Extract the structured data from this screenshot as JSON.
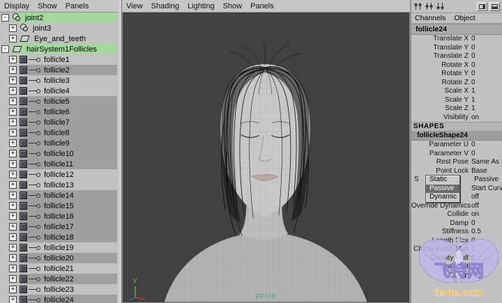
{
  "outliner": {
    "menu": [
      {
        "label": "Display"
      },
      {
        "label": "Show"
      },
      {
        "label": "Panels"
      }
    ],
    "items": [
      {
        "label": "joint2",
        "icon": "ico-joint",
        "exp": "-",
        "cls": "lvl0 hilite"
      },
      {
        "label": "joint3",
        "icon": "ico-joint",
        "exp": "+",
        "cls": "lvl1"
      },
      {
        "label": "Eye_and_teeth",
        "icon": "ico-mesh",
        "exp": "+",
        "cls": "lvl1"
      },
      {
        "label": "hairSystem1Follicles",
        "icon": "ico-mesh",
        "exp": "-",
        "cls": "lvl0 hilite"
      },
      {
        "label": "follicle1",
        "icon": "ico-follicle",
        "exp": "+",
        "cls": "lvl1 conn"
      },
      {
        "label": "follicle2",
        "icon": "ico-follicle",
        "exp": "+",
        "cls": "lvl1 conn sel"
      },
      {
        "label": "follicle3",
        "icon": "ico-follicle",
        "exp": "+",
        "cls": "lvl1 conn"
      },
      {
        "label": "follicle4",
        "icon": "ico-follicle",
        "exp": "+",
        "cls": "lvl1 conn"
      },
      {
        "label": "follicle5",
        "icon": "ico-follicle",
        "exp": "+",
        "cls": "lvl1 conn sel"
      },
      {
        "label": "follicle6",
        "icon": "ico-follicle",
        "exp": "+",
        "cls": "lvl1 conn sel"
      },
      {
        "label": "follicle7",
        "icon": "ico-follicle",
        "exp": "+",
        "cls": "lvl1 conn sel"
      },
      {
        "label": "follicle8",
        "icon": "ico-follicle",
        "exp": "+",
        "cls": "lvl1 conn sel"
      },
      {
        "label": "follicle9",
        "icon": "ico-follicle",
        "exp": "+",
        "cls": "lvl1 conn sel"
      },
      {
        "label": "follicle10",
        "icon": "ico-follicle",
        "exp": "+",
        "cls": "lvl1 conn sel"
      },
      {
        "label": "follicle11",
        "icon": "ico-follicle",
        "exp": "+",
        "cls": "lvl1 conn sel"
      },
      {
        "label": "follicle12",
        "icon": "ico-follicle",
        "exp": "+",
        "cls": "lvl1 conn"
      },
      {
        "label": "follicle13",
        "icon": "ico-follicle",
        "exp": "+",
        "cls": "lvl1 conn"
      },
      {
        "label": "follicle14",
        "icon": "ico-follicle",
        "exp": "+",
        "cls": "lvl1 conn sel"
      },
      {
        "label": "follicle15",
        "icon": "ico-follicle",
        "exp": "+",
        "cls": "lvl1 conn sel"
      },
      {
        "label": "follicle16",
        "icon": "ico-follicle",
        "exp": "+",
        "cls": "lvl1 conn sel"
      },
      {
        "label": "follicle17",
        "icon": "ico-follicle",
        "exp": "+",
        "cls": "lvl1 conn sel"
      },
      {
        "label": "follicle18",
        "icon": "ico-follicle",
        "exp": "+",
        "cls": "lvl1 conn sel"
      },
      {
        "label": "follicle19",
        "icon": "ico-follicle",
        "exp": "+",
        "cls": "lvl1 conn"
      },
      {
        "label": "follicle20",
        "icon": "ico-follicle",
        "exp": "+",
        "cls": "lvl1 conn sel"
      },
      {
        "label": "follicle21",
        "icon": "ico-follicle",
        "exp": "+",
        "cls": "lvl1 conn"
      },
      {
        "label": "follicle22",
        "icon": "ico-follicle",
        "exp": "+",
        "cls": "lvl1 conn sel"
      },
      {
        "label": "follicle23",
        "icon": "ico-follicle",
        "exp": "+",
        "cls": "lvl1 conn"
      },
      {
        "label": "follicle24",
        "icon": "ico-follicle",
        "exp": "+",
        "cls": "lvl1 conn sel"
      }
    ]
  },
  "viewport": {
    "menu": [
      {
        "label": "View"
      },
      {
        "label": "Shading"
      },
      {
        "label": "Lighting"
      },
      {
        "label": "Show"
      },
      {
        "label": "Panels"
      }
    ],
    "camera_label": "persp",
    "axis_y_label": "Y"
  },
  "channel_box": {
    "tabs": [
      {
        "label": "Channels"
      },
      {
        "label": "Object"
      }
    ],
    "node_name": "follicle24",
    "transform_rows": [
      {
        "label": "Translate X",
        "value": "0",
        "cls": ""
      },
      {
        "label": "Translate Y",
        "value": "0",
        "cls": ""
      },
      {
        "label": "Translate Z",
        "value": "0",
        "cls": ""
      },
      {
        "label": "Rotate X",
        "value": "0",
        "cls": ""
      },
      {
        "label": "Rotate Y",
        "value": "0",
        "cls": ""
      },
      {
        "label": "Rotate Z",
        "value": "0",
        "cls": ""
      },
      {
        "label": "Scale X",
        "value": "1",
        "cls": ""
      },
      {
        "label": "Scale Y",
        "value": "1",
        "cls": ""
      },
      {
        "label": "Scale Z",
        "value": "1",
        "cls": ""
      },
      {
        "label": "Visibility",
        "value": "on",
        "cls": ""
      }
    ],
    "shapes_header": "SHAPES",
    "shape_name": "follicleShape24",
    "shape_rows": [
      {
        "label": "Parameter U",
        "value": "0",
        "cls": ""
      },
      {
        "label": "Parameter V",
        "value": "0",
        "cls": ""
      },
      {
        "label": "Rest Pose",
        "value": "Same As St",
        "cls": ""
      },
      {
        "label": "Point Lock",
        "value": "Base",
        "cls": ""
      },
      {
        "label": "S",
        "value": "Passive",
        "cls": "lalign"
      },
      {
        "label": "",
        "value": "Start Curve",
        "cls": ""
      },
      {
        "label": "",
        "value": "off",
        "cls": ""
      },
      {
        "label": "Override Dynamics",
        "value": "off",
        "cls": ""
      },
      {
        "label": "Collide",
        "value": "on",
        "cls": ""
      },
      {
        "label": "Damp",
        "value": "0",
        "cls": ""
      },
      {
        "label": "Stiffness",
        "value": "0.5",
        "cls": ""
      },
      {
        "label": "Length Flex",
        "value": "0",
        "cls": ""
      },
      {
        "label": "Clump Width Mult",
        "value": "1",
        "cls": ""
      },
      {
        "label": "Density Mult",
        "value": "1",
        "cls": ""
      },
      {
        "label": "Curl Mult",
        "value": "1",
        "cls": ""
      },
      {
        "label": "Clump",
        "value": "",
        "cls": ""
      }
    ],
    "popup": {
      "options": [
        {
          "label": "Static",
          "cls": ""
        },
        {
          "label": "Passive",
          "cls": "selected"
        },
        {
          "label": "Dynamic",
          "cls": ""
        }
      ]
    }
  },
  "watermark": {
    "cn": "飞特网",
    "en": "fevte.com"
  }
}
